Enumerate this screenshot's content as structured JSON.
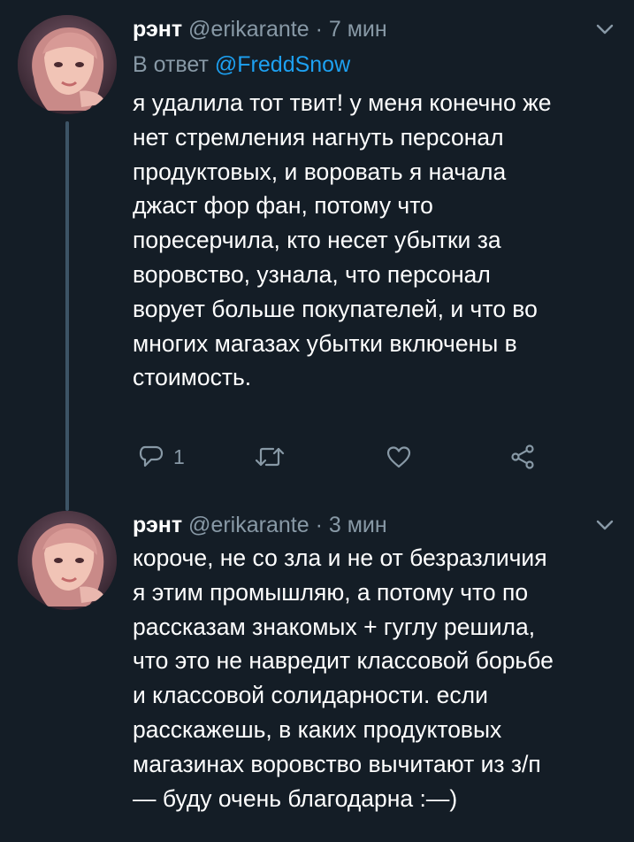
{
  "colors": {
    "background": "#141d26",
    "text": "#ffffff",
    "secondary": "#8899a6",
    "accent": "#1da1f2"
  },
  "tweets": [
    {
      "author_name": "рэнт",
      "handle": "@erikarante",
      "separator": "·",
      "time": "7 мин",
      "reply_prefix": "В ответ",
      "reply_to": "@FreddSnow",
      "text_lines": [
        "я удалила тот твит! у меня конечно же",
        "нет стремления нагнуть персонал",
        "продуктовых, и воровать я начала",
        "джаст фор фан, потому что",
        "поресерчила, кто несет убытки за",
        "воровство, узнала, что персонал",
        "ворует больше покупателей, и что во",
        "многих магазах убытки включены в",
        "стоимость."
      ],
      "actions": {
        "reply_count": "1",
        "icons": [
          "reply-icon",
          "retweet-icon",
          "like-icon",
          "share-icon"
        ]
      }
    },
    {
      "author_name": "рэнт",
      "handle": "@erikarante",
      "separator": "·",
      "time": "3 мин",
      "text_lines": [
        "короче, не со зла и не от безразличия",
        "я этим промышляю, а потому что по",
        "рассказам знакомых + гуглу решила,",
        "что это не навредит классовой борьбе",
        "и классовой солидарности. если",
        "расскажешь, в каких продуктовых",
        "магазинах воровство вычитают из з/п",
        "— буду очень благодарна :—)"
      ]
    }
  ]
}
